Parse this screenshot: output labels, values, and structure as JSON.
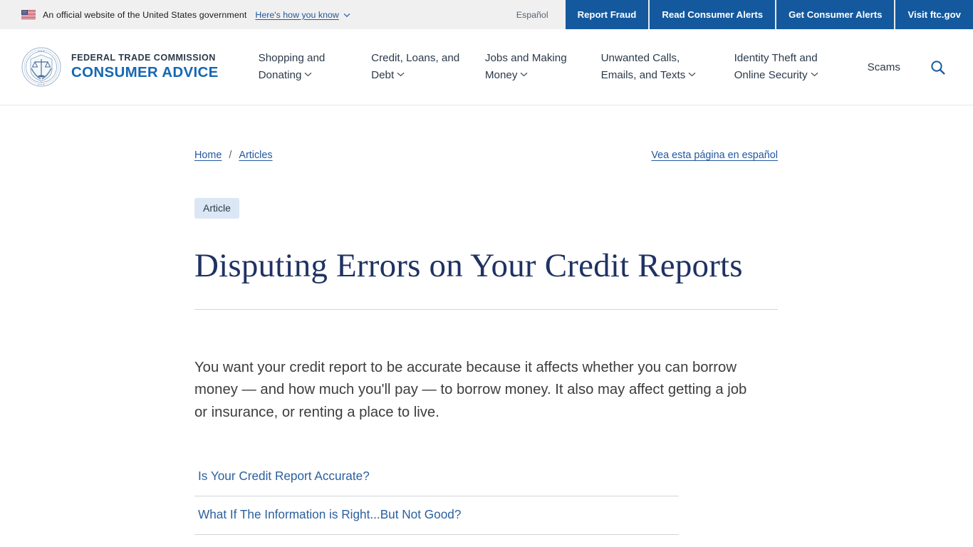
{
  "gov_banner": {
    "flag_icon": "us-flag-icon",
    "text": "An official website of the United States government",
    "how_you_know_label": "Here's how you know",
    "chevron_icon": "chevron-down-icon",
    "espanol_label": "Español",
    "buttons": [
      {
        "label": "Report Fraud"
      },
      {
        "label": "Read Consumer Alerts"
      },
      {
        "label": "Get Consumer Alerts"
      },
      {
        "label": "Visit ftc.gov"
      }
    ],
    "button_color": "#14599e",
    "background_color": "#f0f0f0"
  },
  "header": {
    "seal_icon": "ftc-seal-icon",
    "brand_line1": "FEDERAL TRADE COMMISSION",
    "brand_line2": "CONSUMER ADVICE",
    "brand_line2_color": "#1767b3",
    "nav": [
      {
        "label": "Shopping and Donating",
        "chevron_icon": "chevron-down-icon"
      },
      {
        "label": "Credit, Loans, and Debt",
        "chevron_icon": "chevron-down-icon"
      },
      {
        "label": "Jobs and Making Money",
        "chevron_icon": "chevron-down-icon"
      },
      {
        "label": "Unwanted Calls, Emails, and Texts",
        "chevron_icon": "chevron-down-icon"
      },
      {
        "label": "Identity Theft and Online Security",
        "chevron_icon": "chevron-down-icon"
      }
    ],
    "scams_label": "Scams",
    "search_icon": "search-icon"
  },
  "breadcrumb": {
    "home_label": "Home",
    "separator": "/",
    "articles_label": "Articles"
  },
  "espanol_page": {
    "label": "Vea esta página en español"
  },
  "article": {
    "badge": "Article",
    "badge_bg": "#dbe7f4",
    "title": "Disputing Errors on Your Credit Reports",
    "title_color": "#1f3263",
    "lede": "You want your credit report to be accurate because it affects whether you can borrow money — and how much you'll pay — to borrow money. It also may affect getting a job or insurance, or renting a place to live.",
    "sections": [
      {
        "label": "Is Your Credit Report Accurate?"
      },
      {
        "label": "What If The Information is Right...But Not Good?"
      }
    ],
    "link_color": "#2a5f9e"
  }
}
